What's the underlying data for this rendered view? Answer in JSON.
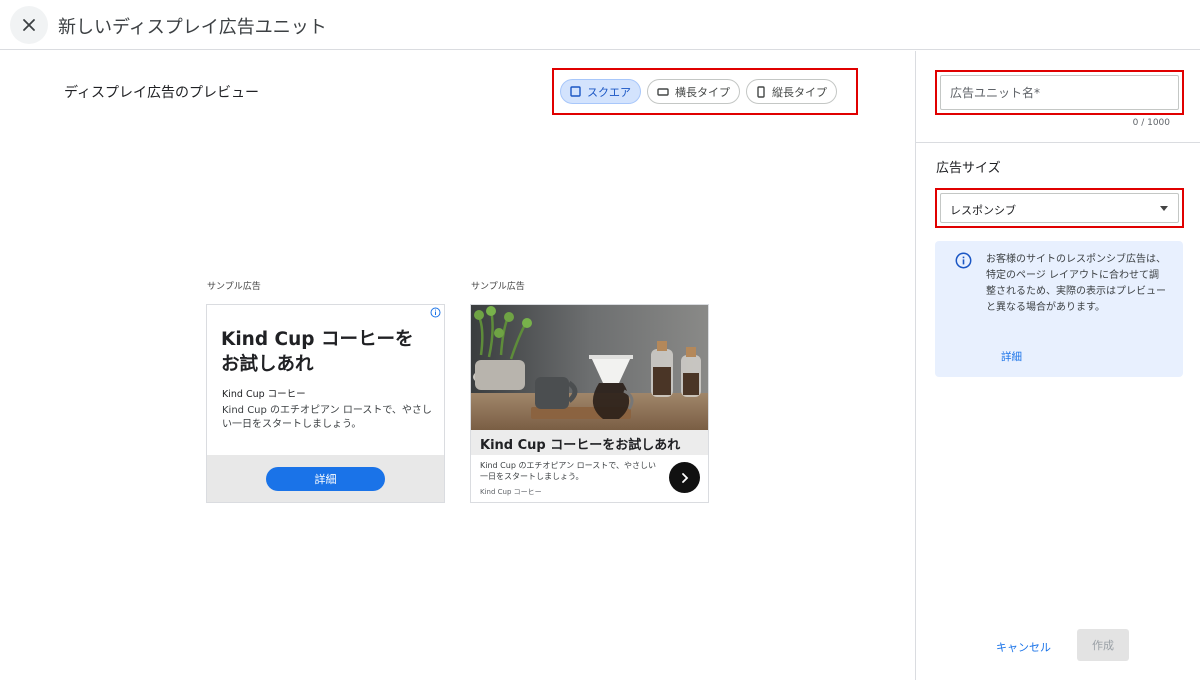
{
  "header": {
    "close_icon": "close-icon",
    "title": "新しいディスプレイ広告ユニット"
  },
  "preview": {
    "title": "ディスプレイ広告のプレビュー",
    "shapes": [
      {
        "label": "スクエア",
        "icon": "square-icon",
        "selected": true
      },
      {
        "label": "横長タイプ",
        "icon": "horizontal-rect-icon",
        "selected": false
      },
      {
        "label": "縦長タイプ",
        "icon": "vertical-rect-icon",
        "selected": false
      }
    ],
    "samples": [
      {
        "label": "サンプル広告",
        "headline": "Kind Cup コーヒーを お試しあれ",
        "brand": "Kind Cup コーヒー",
        "description": "Kind Cup のエチオピアン ローストで、やさしい一日をスタートしましょう。",
        "cta": "詳細",
        "adchoices_icon": "info-icon"
      },
      {
        "label": "サンプル広告",
        "headline": "Kind Cup コーヒーをお試しあれ",
        "description": "Kind Cup のエチオピアン ローストで、やさしい一日をスタートしましょう。",
        "brand": "Kind Cup コーヒー",
        "arrow_icon": "chevron-right-icon",
        "image": "coffee-photo"
      }
    ]
  },
  "panel": {
    "name_placeholder": "広告ユニット名*",
    "name_counter": "0 / 1000",
    "size_label": "広告サイズ",
    "size_value": "レスポンシブ",
    "info_text": "お客様のサイトのレスポンシブ広告は、特定のページ レイアウトに合わせて調整されるため、実際の表示はプレビューと異なる場合があります。",
    "info_link": "詳細",
    "cancel_label": "キャンセル",
    "create_label": "作成"
  },
  "colors": {
    "accent": "#1a73e8",
    "highlight_border": "#e00000",
    "info_bg": "#e8f0fe",
    "selected_chip_bg": "#d3e3fd"
  }
}
